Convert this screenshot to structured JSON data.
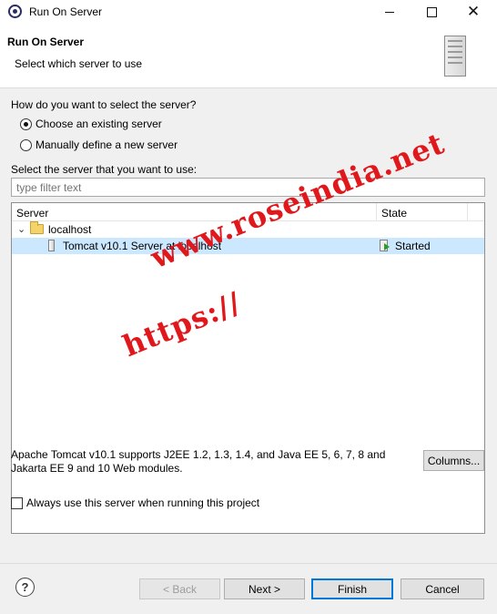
{
  "window": {
    "title": "Run On Server"
  },
  "header": {
    "title": "Run On Server",
    "subtitle": "Select which server to use"
  },
  "selection": {
    "question": "How do you want to select the server?",
    "options": [
      {
        "label": "Choose an existing server",
        "checked": true
      },
      {
        "label": "Manually define a new server",
        "checked": false
      }
    ],
    "list_label": "Select the server that you want to use:",
    "filter_placeholder": "type filter text"
  },
  "table": {
    "columns": [
      "Server",
      "State"
    ],
    "group": {
      "label": "localhost"
    },
    "rows": [
      {
        "name": "Tomcat v10.1 Server at localhost",
        "state": "Started",
        "selected": true
      }
    ]
  },
  "watermark": {
    "line1": "www.roseindia.net",
    "line2": "https://"
  },
  "description": "Apache Tomcat v10.1 supports J2EE 1.2, 1.3, 1.4, and Java EE 5, 6, 7, 8 and Jakarta EE 9 and 10 Web modules.",
  "columns_button": "Columns...",
  "always_checkbox": {
    "label": "Always use this server when running this project",
    "checked": false
  },
  "footer": {
    "help_symbol": "?",
    "back": "< Back",
    "next": "Next >",
    "finish": "Finish",
    "cancel": "Cancel"
  }
}
